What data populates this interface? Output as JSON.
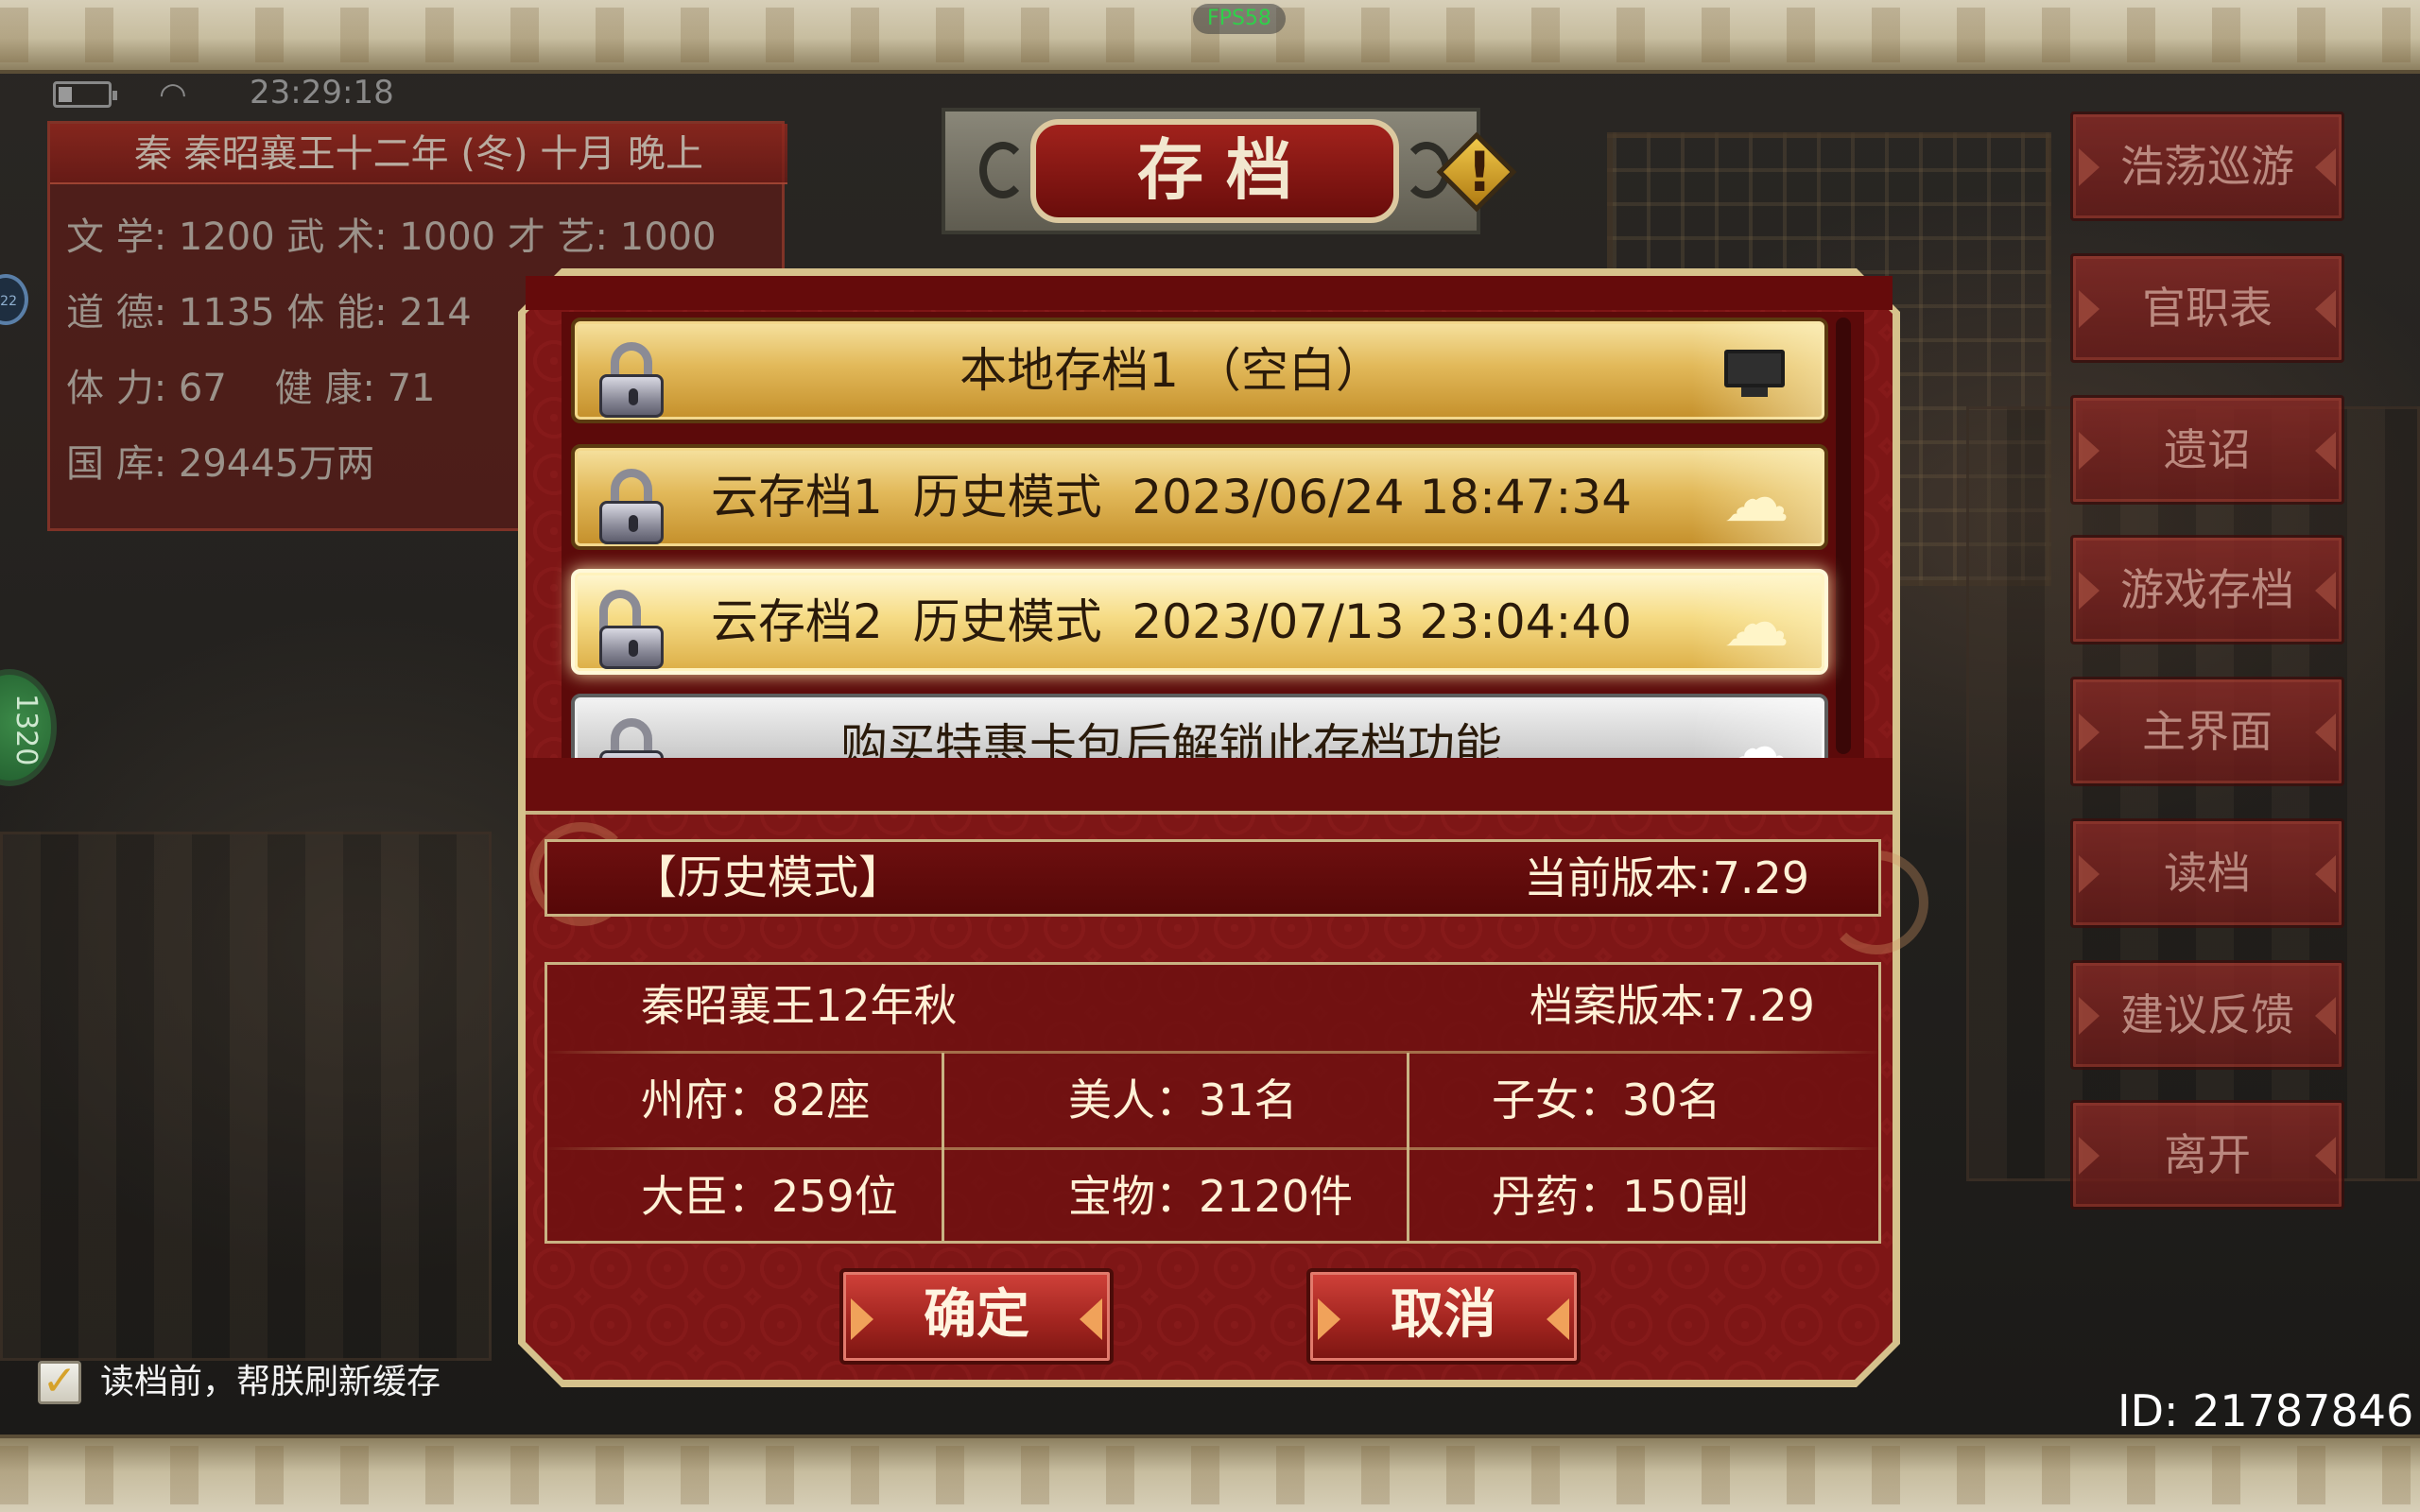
{
  "status_bar": {
    "time": "23:29:18",
    "fps": "FPS58"
  },
  "player_info": {
    "title": "秦 秦昭襄王十二年 (冬) 十月 晚上",
    "lines": [
      "文 学: 1200 武 术: 1000 才 艺: 1000",
      "道 德: 1135 体 能: 214",
      "体 力: 67    健 康: 71",
      "国 库: 29445万两"
    ]
  },
  "side_badge": {
    "blue_text": "22",
    "green_text": "1320"
  },
  "right_menu": [
    "浩荡巡游",
    "官职表",
    "遗诏",
    "游戏存档",
    "主界面",
    "读档",
    "建议反馈",
    "离开"
  ],
  "dialog": {
    "title": "存档",
    "slots": [
      {
        "text": "本地存档1 （空白）",
        "state": "normal",
        "left_icon": "lock-icon",
        "right_icon": "monitor-icon"
      },
      {
        "text": "云存档1  历史模式  2023/06/24 18:47:34",
        "state": "normal",
        "left_icon": "lock-icon",
        "right_icon": "cloud-icon"
      },
      {
        "text": "云存档2  历史模式  2023/07/13 23:04:40",
        "state": "selected",
        "left_icon": "unlocked-lock-icon",
        "right_icon": "cloud-icon"
      },
      {
        "text": "购买特惠卡包后解锁此存档功能",
        "state": "locked",
        "left_icon": "lock-icon",
        "right_icon": "cloud-icon"
      }
    ],
    "mode_label": "【历史模式】",
    "current_version": "当前版本:7.29",
    "save_date": "秦昭襄王12年秋",
    "save_version": "档案版本:7.29",
    "stats": [
      [
        "州府：82座",
        "美人：31名",
        "子女：30名"
      ],
      [
        "大臣：259位",
        "宝物：2120件",
        "丹药：150副"
      ]
    ],
    "confirm_label": "确定",
    "cancel_label": "取消"
  },
  "refresh_cache": {
    "checked": true,
    "label": "读档前，帮朕刷新缓存"
  },
  "user_id": "ID: 21787846",
  "colors": {
    "dialog_red": "#7e1616",
    "gold_slot": "#e2b95a",
    "menu_red": "#8e2a26"
  }
}
